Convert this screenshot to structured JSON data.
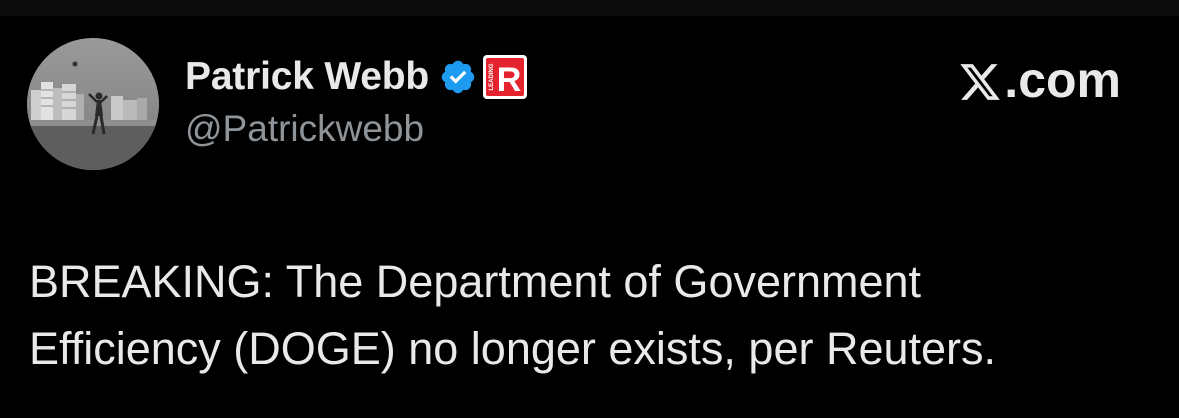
{
  "author": {
    "display_name": "Patrick Webb",
    "handle": "@Patrickwebb",
    "verified_icon": "verified-checkmark-icon",
    "affiliate_badge_icon": "affiliate-badge-icon",
    "affiliate_badge_letter": "R",
    "affiliate_badge_caption": "LEADING",
    "verified_color": "#1d9bf0",
    "affiliate_color": "#e4232e"
  },
  "source": {
    "site_suffix": ".com",
    "logo_icon": "x-logo-icon"
  },
  "tweet": {
    "lines": [
      "BREAKING: The Department of Government",
      "Efficiency (DOGE) no longer exists, per Reuters."
    ]
  },
  "colors": {
    "background": "#000000",
    "text_primary": "#e7e9ea",
    "text_secondary": "#8f9499"
  }
}
